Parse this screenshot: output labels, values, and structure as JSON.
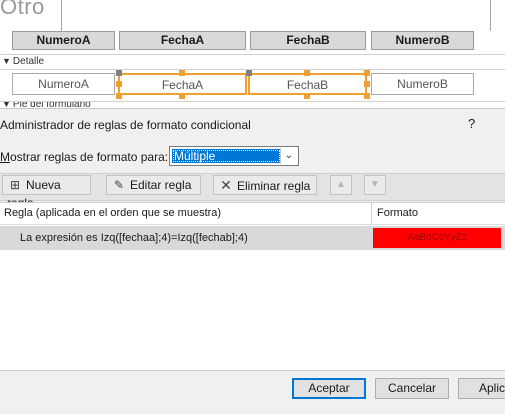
{
  "form": {
    "title_partial": "Otro",
    "headers": [
      "NumeroA",
      "FechaA",
      "FechaB",
      "NumeroB"
    ],
    "detail_section_label": "Detalle",
    "detail_fields": [
      "NumeroA",
      "FechaA",
      "FechaB",
      "NumeroB"
    ],
    "footer_section_label": "Pie del formulario"
  },
  "dialog": {
    "title": "Administrador de reglas de formato condicional",
    "help": "?",
    "show_rules_label": "Mostrar reglas de formato para:",
    "show_rules_value": "Múltiple",
    "toolbar": {
      "new_rule": "Nueva regla",
      "edit_rule": "Editar regla",
      "delete_rule": "Eliminar regla"
    },
    "columns": {
      "rule": "Regla (aplicada en el orden que se muestra)",
      "format": "Formato"
    },
    "rules": [
      {
        "expression": "La expresión es Izq([fechaa];4)=Izq([fechab];4)",
        "preview": "AaBbCcYyZz"
      }
    ],
    "buttons": {
      "accept": "Aceptar",
      "cancel": "Cancelar",
      "apply_partial": "Aplic"
    }
  },
  "colors": {
    "selection": "#f0a030",
    "highlight": "#0078d7",
    "format_fill": "#ff0000"
  }
}
